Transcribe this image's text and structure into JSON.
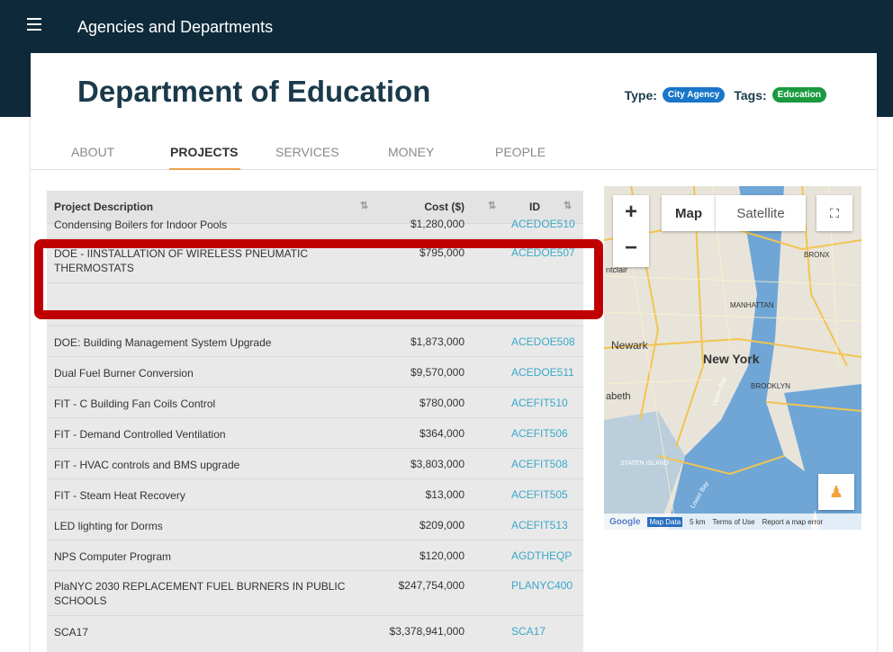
{
  "header": {
    "title": "Agencies and Departments"
  },
  "page": {
    "title": "Department of Education",
    "type_label": "Type:",
    "type_value": "City Agency",
    "tags_label": "Tags:",
    "tag_value": "Education"
  },
  "tabs": [
    {
      "label": "ABOUT"
    },
    {
      "label": "PROJECTS"
    },
    {
      "label": "SERVICES"
    },
    {
      "label": "MONEY"
    },
    {
      "label": "PEOPLE"
    }
  ],
  "table": {
    "columns": [
      "Project Description",
      "Cost ($)",
      "ID"
    ],
    "rows": [
      {
        "desc": "Condensing Boilers for Indoor Pools",
        "cost": "$1,280,000",
        "id": "ACEDOE510"
      },
      {
        "desc": "DOE - IINSTALLATION OF WIRELESS PNEUMATIC THERMOSTATS",
        "cost": "$795,000",
        "id": "ACEDOE507"
      },
      {
        "desc": "DOE: Building Management System Upgrade",
        "cost": "$1,873,000",
        "id": "ACEDOE508"
      },
      {
        "desc": "Dual Fuel Burner Conversion",
        "cost": "$9,570,000",
        "id": "ACEDOE511"
      },
      {
        "desc": "FIT - C Building Fan Coils Control",
        "cost": "$780,000",
        "id": "ACEFIT510"
      },
      {
        "desc": "FIT - Demand Controlled Ventilation",
        "cost": "$364,000",
        "id": "ACEFIT506"
      },
      {
        "desc": "FIT - HVAC controls and BMS upgrade",
        "cost": "$3,803,000",
        "id": "ACEFIT508"
      },
      {
        "desc": "FIT - Steam Heat Recovery",
        "cost": "$13,000",
        "id": "ACEFIT505"
      },
      {
        "desc": "LED lighting for Dorms",
        "cost": "$209,000",
        "id": "ACEFIT513"
      },
      {
        "desc": "NPS Computer Program",
        "cost": "$120,000",
        "id": "AGDTHEQP"
      },
      {
        "desc": "PlaNYC 2030 REPLACEMENT FUEL BURNERS IN PUBLIC SCHOOLS",
        "cost": "$247,754,000",
        "id": "PLANYC400"
      },
      {
        "desc": "SCA17",
        "cost": "$3,378,941,000",
        "id": "SCA17"
      }
    ]
  },
  "map": {
    "map_button": "Map",
    "satellite_button": "Satellite",
    "zoom_in": "+",
    "zoom_out": "−",
    "labels": {
      "newark": "Newark",
      "new_york": "New York",
      "manhattan": "MANHATTAN",
      "brooklyn": "BROOKLYN",
      "bronx": "BRONX",
      "staten_island": "STATEN ISLAND",
      "upper_bay": "Upper Bay",
      "lower_bay": "Lower Bay",
      "montclair": "ntclair",
      "elizabeth": "abeth"
    },
    "attribution": {
      "google": "Google",
      "map_data": "Map Data",
      "scale": "5 km",
      "terms": "Terms of Use",
      "report": "Report a map error"
    }
  }
}
